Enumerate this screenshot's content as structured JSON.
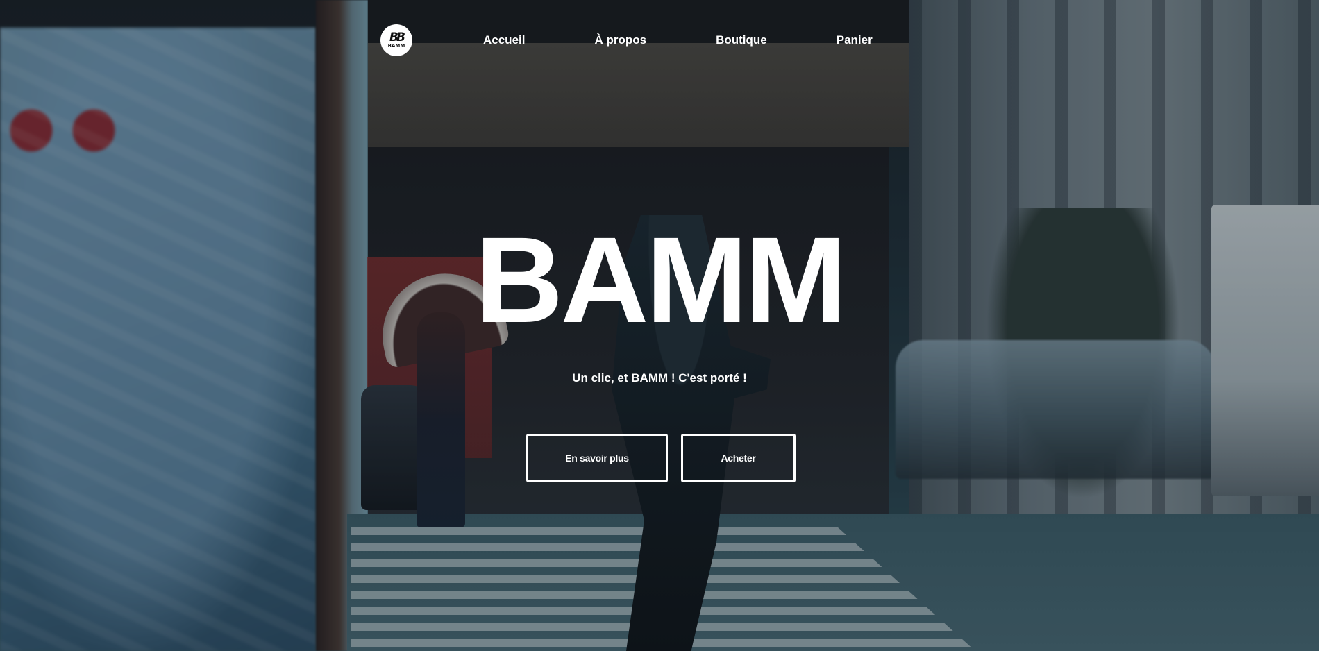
{
  "brand": {
    "logo_mark": "BB",
    "logo_text": "BAMM"
  },
  "nav": {
    "items": [
      {
        "label": "Accueil"
      },
      {
        "label": "À propos"
      },
      {
        "label": "Boutique"
      },
      {
        "label": "Panier"
      }
    ]
  },
  "hero": {
    "title": "BAMM",
    "subtitle": "Un clic, et BAMM ! C'est porté !",
    "buttons": {
      "learn_more": "En savoir plus",
      "buy": "Acheter"
    }
  },
  "colors": {
    "text": "#ffffff",
    "button_border": "#ffffff",
    "logo_background": "#ffffff"
  }
}
